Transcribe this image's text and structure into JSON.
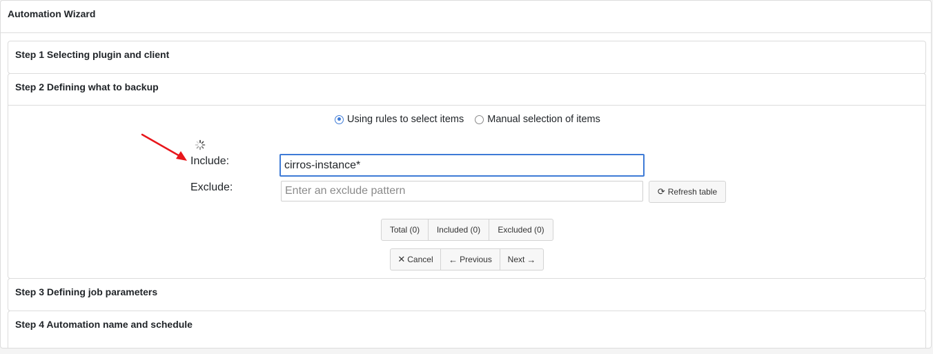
{
  "wizard": {
    "title": "Automation Wizard"
  },
  "steps": [
    {
      "title": "Step 1 Selecting plugin and client"
    },
    {
      "title": "Step 2 Defining what to backup"
    },
    {
      "title": "Step 3 Defining job parameters"
    },
    {
      "title": "Step 4 Automation name and schedule"
    }
  ],
  "selection_mode": {
    "options": [
      {
        "label": "Using rules to select items",
        "selected": true
      },
      {
        "label": "Manual selection of items",
        "selected": false
      }
    ]
  },
  "filters": {
    "include_label": "Include:",
    "include_value": "cirros-instance*",
    "exclude_label": "Exclude:",
    "exclude_value": "",
    "exclude_placeholder": "Enter an exclude pattern",
    "refresh_label": "Refresh table",
    "refresh_icon": "refresh-icon"
  },
  "counts": {
    "total": "Total (0)",
    "included": "Included (0)",
    "excluded": "Excluded (0)"
  },
  "nav": {
    "cancel": "Cancel",
    "cancel_icon": "close-icon",
    "previous": "Previous",
    "previous_icon": "arrow-left-icon",
    "next": "Next",
    "next_icon": "arrow-right-icon"
  },
  "colors": {
    "accent": "#3d7ad6",
    "annotation_arrow": "#e8161b"
  }
}
